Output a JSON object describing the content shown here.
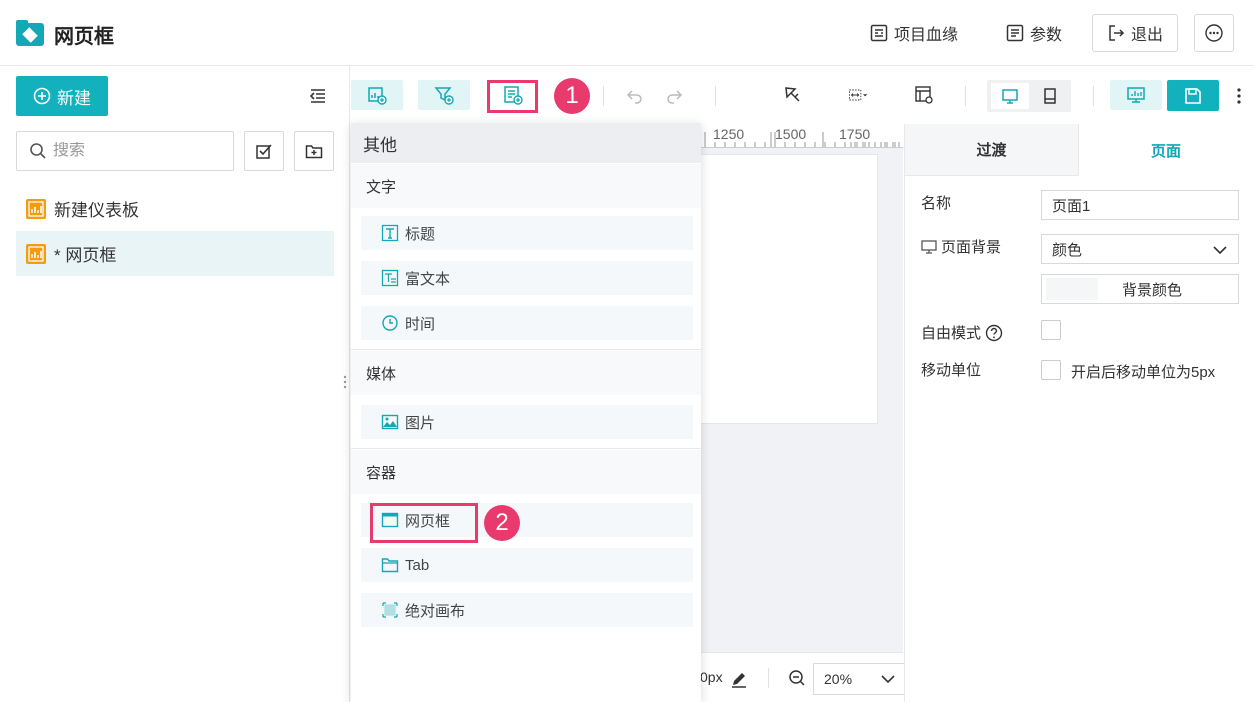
{
  "header": {
    "title": "网页框",
    "lineage_label": "项目血缘",
    "params_label": "参数",
    "logout_label": "退出"
  },
  "left": {
    "new_label": "新建",
    "search_placeholder": "搜索",
    "items": [
      {
        "label": "新建仪表板"
      },
      {
        "label": "* 网页框"
      }
    ]
  },
  "toolbar": {
    "badge1": "1"
  },
  "ruler": {
    "labels": [
      "1250",
      "1500",
      "1750"
    ]
  },
  "canvas": {
    "px_text": "0px",
    "zoom": "20%"
  },
  "menu": {
    "header": "其他",
    "sections": [
      {
        "title": "文字",
        "items": [
          "标题",
          "富文本",
          "时间"
        ]
      },
      {
        "title": "媒体",
        "items": [
          "图片"
        ]
      },
      {
        "title": "容器",
        "items": [
          "网页框",
          "Tab",
          "绝对画布"
        ]
      }
    ],
    "badge2": "2"
  },
  "right": {
    "tab_transition": "过渡",
    "tab_page": "页面",
    "name_label": "名称",
    "name_value": "页面1",
    "bg_label": "页面背景",
    "bg_value": "颜色",
    "bg_color_label": "背景颜色",
    "free_mode_label": "自由模式",
    "move_unit_label": "移动单位",
    "move_unit_text": "开启后移动单位为5px"
  },
  "colors": {
    "accent": "#13b1bd",
    "marker": "#e83a6d",
    "dashboard_icon": "#f39c12"
  }
}
